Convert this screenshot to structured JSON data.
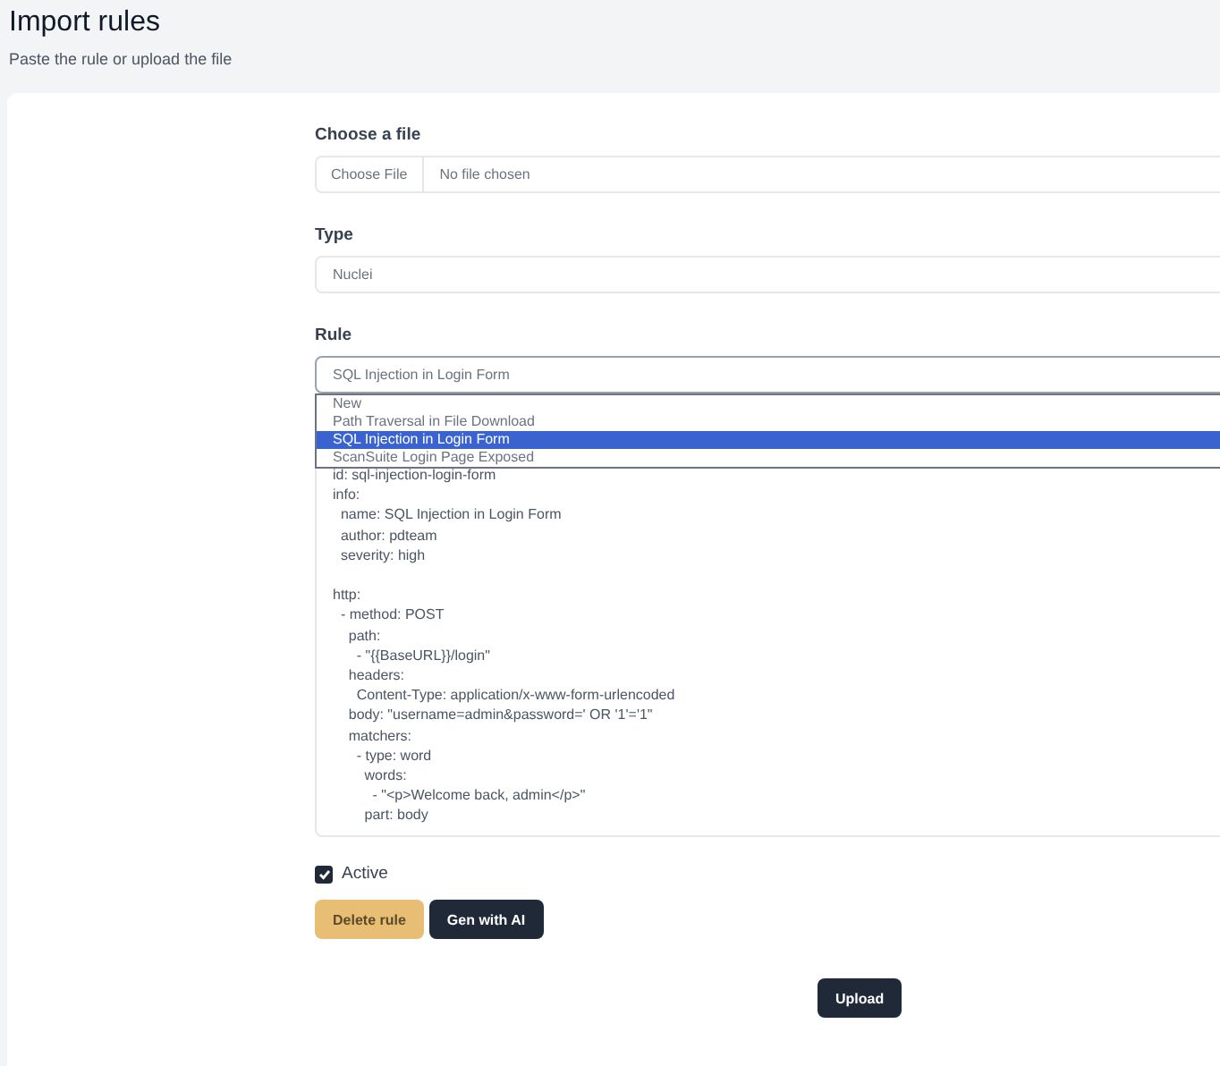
{
  "header": {
    "title": "Import rules",
    "subtitle": "Paste the rule or upload the file"
  },
  "file": {
    "label": "Choose a file",
    "button": "Choose File",
    "status": "No file chosen"
  },
  "type": {
    "label": "Type",
    "value": "Nuclei"
  },
  "rule": {
    "label": "Rule",
    "value": "SQL Injection in Login Form",
    "expanded": true,
    "options": [
      {
        "label": "New",
        "selected": false
      },
      {
        "label": "Path Traversal in File Download",
        "selected": false
      },
      {
        "label": "SQL Injection in Login Form",
        "selected": true
      },
      {
        "label": "ScanSuite Login Page Exposed",
        "selected": false
      }
    ]
  },
  "code": "id: sql-injection-login-form\ninfo:\n  name: SQL Injection in Login Form\n  author: pdteam\n  severity: high\n\nhttp:\n  - method: POST\n    path:\n      - \"{{BaseURL}}/login\"\n    headers:\n      Content-Type: application/x-www-form-urlencoded\n    body: \"username=admin&password=' OR '1'='1\"\n    matchers:\n      - type: word\n        words:\n          - \"<p>Welcome back, admin</p>\"\n        part: body",
  "active": {
    "label": "Active",
    "checked": true
  },
  "buttons": [
    {
      "label": "Delete rule",
      "kind": "warning"
    },
    {
      "label": "Gen with AI",
      "kind": "dark"
    }
  ],
  "submit": {
    "label": "Upload"
  }
}
